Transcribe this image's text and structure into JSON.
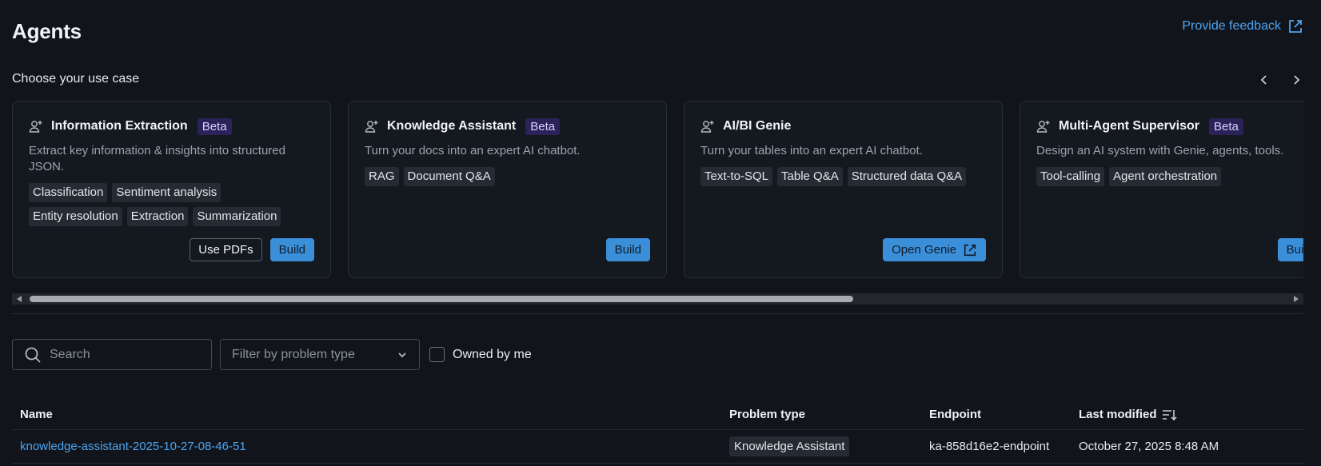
{
  "header": {
    "title": "Agents",
    "feedback_label": "Provide feedback",
    "feedback_icon": "external-link-icon"
  },
  "usecases": {
    "label": "Choose your use case",
    "prev_icon": "chevron-left-icon",
    "next_icon": "chevron-right-icon",
    "cards": [
      {
        "title": "Information Extraction",
        "badge": "Beta",
        "description": "Extract key information & insights into structured JSON.",
        "tags": [
          "Classification",
          "Sentiment analysis",
          "Entity resolution",
          "Extraction",
          "Summarization"
        ],
        "secondary_action": "Use PDFs",
        "primary_action": "Build"
      },
      {
        "title": "Knowledge Assistant",
        "badge": "Beta",
        "description": "Turn your docs into an expert AI chatbot.",
        "tags": [
          "RAG",
          "Document Q&A"
        ],
        "primary_action": "Build"
      },
      {
        "title": "AI/BI Genie",
        "badge": "",
        "description": "Turn your tables into an expert AI chatbot.",
        "tags": [
          "Text-to-SQL",
          "Table Q&A",
          "Structured data Q&A"
        ],
        "primary_action": "Open Genie"
      },
      {
        "title": "Multi-Agent Supervisor",
        "badge": "Beta",
        "description": "Design an AI system with Genie, agents, tools.",
        "tags": [
          "Tool-calling",
          "Agent orchestration"
        ],
        "primary_action": "Build"
      }
    ]
  },
  "filters": {
    "search_placeholder": "Search",
    "problem_type_placeholder": "Filter by problem type",
    "owned_by_me_label": "Owned by me"
  },
  "table": {
    "columns": [
      "Name",
      "Problem type",
      "Endpoint",
      "Last modified"
    ],
    "rows": [
      {
        "name": "knowledge-assistant-2025-10-27-08-46-51",
        "problem_type": "Knowledge Assistant",
        "endpoint": "ka-858d16e2-endpoint",
        "last_modified": "October 27, 2025 8:48 AM"
      }
    ]
  },
  "colors": {
    "background": "#11151b",
    "accent": "#3b8fd9",
    "link": "#4ea3ef",
    "beta_badge_bg": "#2b2259"
  }
}
